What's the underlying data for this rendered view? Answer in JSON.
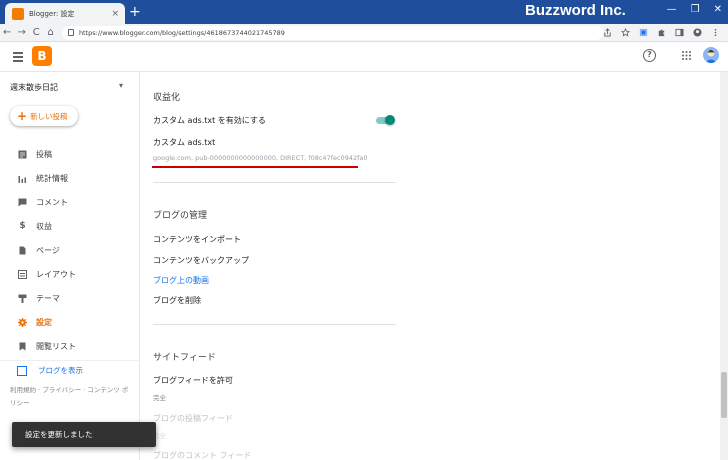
{
  "browser": {
    "tab_title": "Blogger: 設定",
    "tab_close": "×",
    "new_tab": "+",
    "brand": "Buzzword Inc.",
    "url": "https://www.blogger.com/blog/settings/4618673744021745789",
    "controls": [
      "—",
      "❐",
      "✕"
    ],
    "nav": [
      "←",
      "→",
      "C",
      "⌂"
    ]
  },
  "header": {
    "logo_letter": "B",
    "help_glyph": "?"
  },
  "sidebar": {
    "blog_name": "週末散歩日記",
    "new_post": "新しい投稿",
    "items": [
      {
        "label": "投稿",
        "icon": "posts-icon"
      },
      {
        "label": "統計情報",
        "icon": "stats-icon"
      },
      {
        "label": "コメント",
        "icon": "comments-icon"
      },
      {
        "label": "収益",
        "icon": "earnings-icon"
      },
      {
        "label": "ページ",
        "icon": "pages-icon"
      },
      {
        "label": "レイアウト",
        "icon": "layout-icon"
      },
      {
        "label": "テーマ",
        "icon": "theme-icon"
      },
      {
        "label": "設定",
        "icon": "settings-icon"
      },
      {
        "label": "閲覧リスト",
        "icon": "reading-list-icon"
      }
    ],
    "view_blog": "ブログを表示",
    "footer_links": "利用規約 · プライバシー · コンテンツ ポリシー"
  },
  "main": {
    "monetization": {
      "title": "収益化",
      "custom_ads_toggle_label": "カスタム ads.txt を有効にする",
      "custom_ads_toggle_on": true,
      "custom_ads_label": "カスタム ads.txt",
      "custom_ads_value": "google.com, pub-0000000000000000, DIRECT, f08c47fec0942fa0"
    },
    "blog_management": {
      "title": "ブログの管理",
      "import": "コンテンツをインポート",
      "backup": "コンテンツをバックアップ",
      "videos": "ブログ上の動画",
      "delete": "ブログを削除"
    },
    "site_feed": {
      "title": "サイトフィード",
      "allow_feed": "ブログフィードを許可",
      "allow_feed_value": "完全",
      "post_feed": "ブログの投稿フィード",
      "post_feed_value": "完全",
      "comment_feed": "ブログのコメント フィード"
    }
  },
  "toast": {
    "message": "設定を更新しました"
  },
  "colors": {
    "accent": "#e8710a",
    "link": "#1a73e8",
    "toggle": "#00897b",
    "highlight": "#cc0000"
  }
}
